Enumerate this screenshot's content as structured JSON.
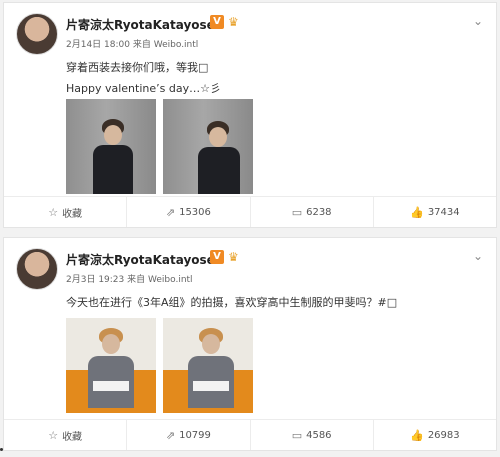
{
  "posts": [
    {
      "author": "片寄涼太RyotaKatayose",
      "verified_icon": "v-badge-icon",
      "time": "2月14日 18:00",
      "source": "来自 Weibo.intl",
      "text_lines": [
        "穿着西装去接你们哦，等我□",
        "Happy valentine’s day…☆彡"
      ],
      "actions": {
        "favorite": "收藏",
        "repost": "15306",
        "comment": "6238",
        "like": "37434"
      }
    },
    {
      "author": "片寄涼太RyotaKatayose",
      "verified_icon": "v-badge-icon",
      "time": "2月3日 19:23",
      "source": "来自 Weibo.intl",
      "text_lines": [
        "今天也在进行《3年A组》的拍摄，喜欢穿高中生制服的甲斐吗？#□"
      ],
      "actions": {
        "favorite": "收藏",
        "repost": "10799",
        "comment": "4586",
        "like": "26983"
      }
    }
  ],
  "colors": {
    "accent": "#f08a24",
    "orange_sofa": "#e38a1c",
    "grey_wall": "#9b9b9b"
  }
}
